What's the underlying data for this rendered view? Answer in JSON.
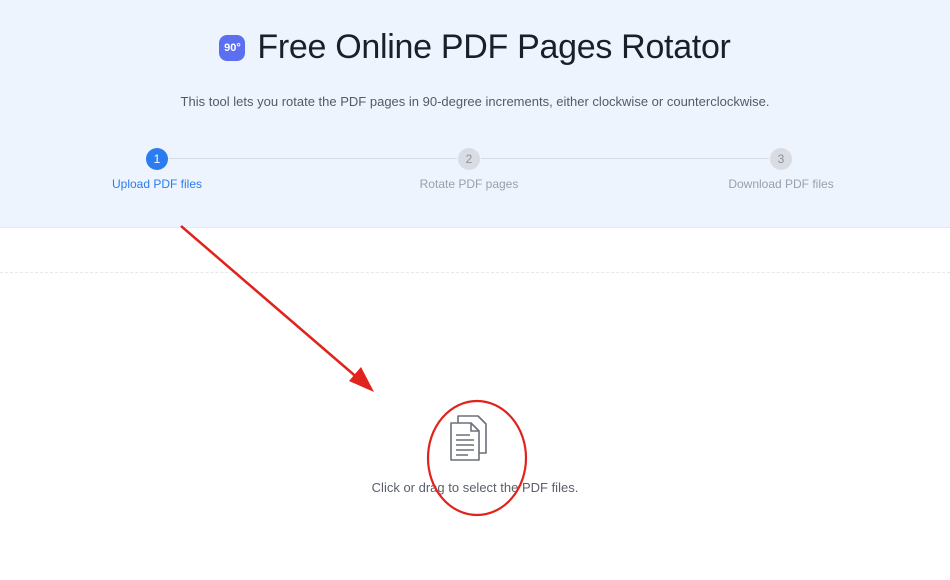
{
  "header": {
    "logo_text": "90°",
    "title": "Free Online PDF Pages Rotator",
    "subtitle": "This tool lets you rotate the PDF pages in 90-degree increments, either clockwise or counterclockwise."
  },
  "steps": [
    {
      "number": "1",
      "label": "Upload PDF files",
      "state": "active"
    },
    {
      "number": "2",
      "label": "Rotate PDF pages",
      "state": "inactive"
    },
    {
      "number": "3",
      "label": "Download PDF files",
      "state": "inactive"
    }
  ],
  "dropzone": {
    "icon": "documents-icon",
    "text": "Click or drag to select the PDF files."
  },
  "annotations": {
    "arrow_color": "#e0231c",
    "circle_color": "#e0231c"
  },
  "colors": {
    "accent": "#2b7cf0",
    "hero_background": "#eef4fd",
    "logo": "#5c6ff0"
  }
}
